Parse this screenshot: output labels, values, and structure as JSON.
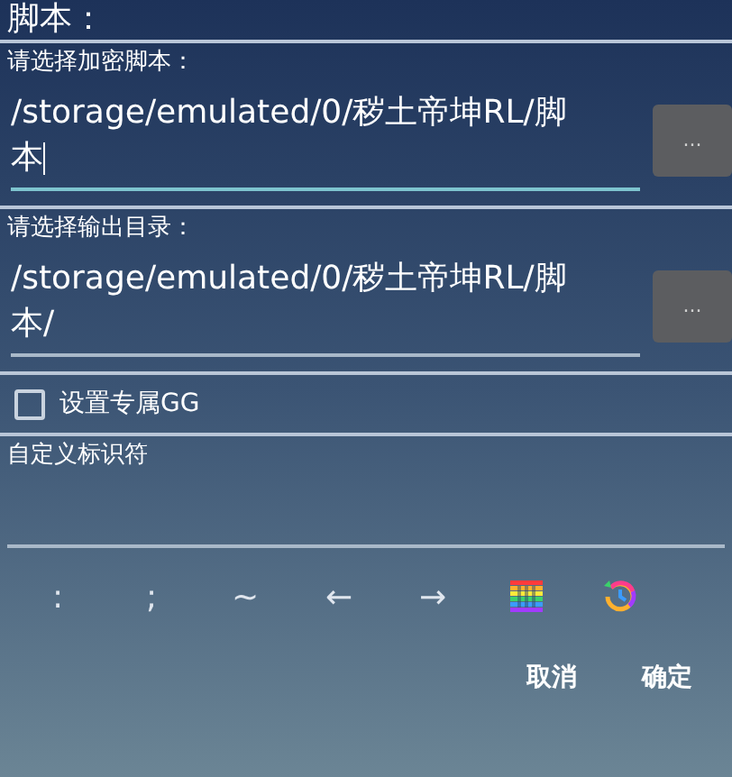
{
  "title": "脚本：",
  "fields": [
    {
      "label": "请选择加密脚本：",
      "value": "/storage/emulated/0/秽土帝坤RL/脚本",
      "focused": true,
      "button": "..."
    },
    {
      "label": "请选择输出目录：",
      "value": "/storage/emulated/0/秽土帝坤RL/脚本/",
      "focused": false,
      "button": "..."
    }
  ],
  "checkbox": {
    "label": "设置专属GG",
    "checked": false
  },
  "identifier": {
    "label": "自定义标识符"
  },
  "keys": [
    {
      "kind": "text",
      "label": ":"
    },
    {
      "kind": "text",
      "label": ";"
    },
    {
      "kind": "text",
      "label": "~"
    },
    {
      "kind": "text",
      "label": "←"
    },
    {
      "kind": "text",
      "label": "→"
    },
    {
      "kind": "grid"
    },
    {
      "kind": "history"
    }
  ],
  "buttons": [
    "取消",
    "确定"
  ]
}
